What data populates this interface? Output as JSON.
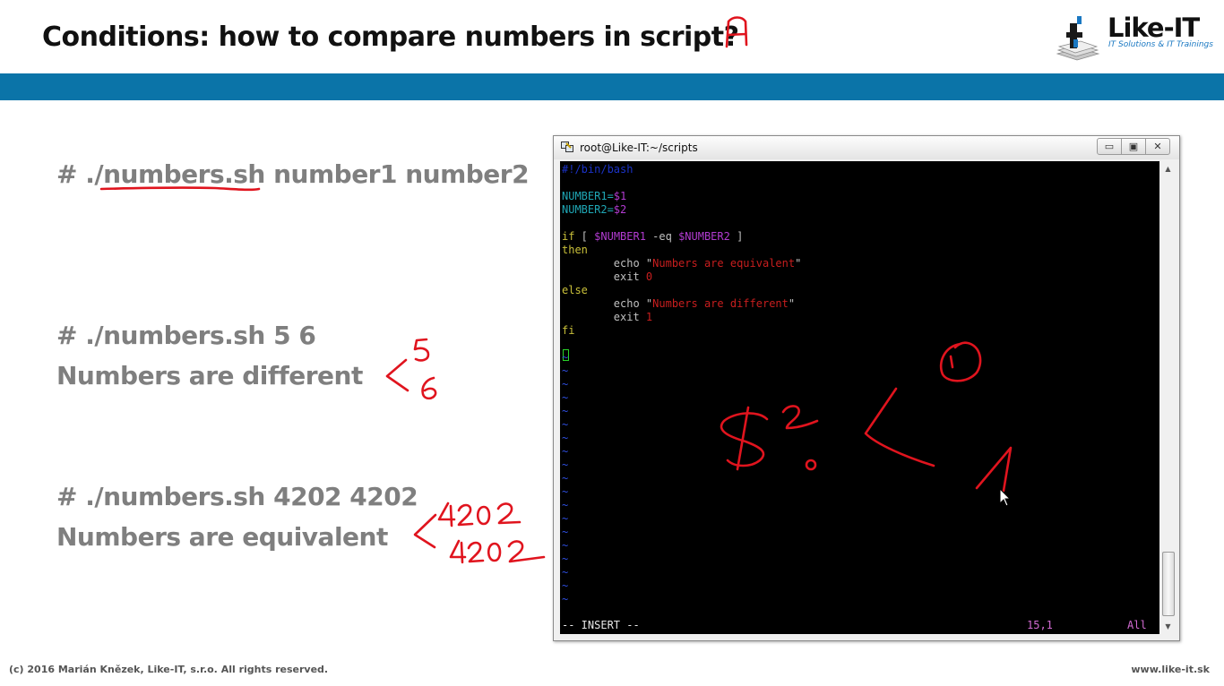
{
  "slide": {
    "title": "Conditions: how to compare numbers in script?",
    "bullets": [
      "# ./numbers.sh number1 number2",
      "# ./numbers.sh 5 6",
      "Numbers are different",
      "# ./numbers.sh 4202 4202",
      "Numbers are equivalent"
    ]
  },
  "logo": {
    "name": "Like-IT",
    "tagline": "IT Solutions & IT Trainings"
  },
  "footer": {
    "copyright": "(c) 2016 Marián Knězek, Like-IT, s.r.o. All rights reserved.",
    "website": "www.like-it.sk"
  },
  "terminal": {
    "title": "root@Like-IT:~/scripts",
    "buttons": {
      "minimize": "▭",
      "maximize": "▣",
      "close": "✕"
    },
    "script": {
      "shebang": "#!/bin/bash",
      "l1_var": "NUMBER1=",
      "l1_val": "$1",
      "l2_var": "NUMBER2=",
      "l2_val": "$2",
      "l3_if": "if",
      "l3_open": " [ ",
      "l3_var1": "$NUMBER1",
      "l3_op": " -eq ",
      "l3_var2": "$NUMBER2",
      "l3_close": " ]",
      "then": "then",
      "echo1_cmd": "        echo ",
      "echo1_q1": "\"",
      "echo1_text": "Numbers are equivalent",
      "echo1_q2": "\"",
      "exit1_cmd": "        exit ",
      "exit1_val": "0",
      "else": "else",
      "echo2_cmd": "        echo ",
      "echo2_q1": "\"",
      "echo2_text": "Numbers are different",
      "echo2_q2": "\"",
      "exit2_cmd": "        exit ",
      "exit2_val": "1",
      "fi": "fi"
    },
    "tilde": "~",
    "mode": "-- INSERT --",
    "position": "15,1",
    "scroll": "All"
  },
  "annotations": {
    "letter": "A",
    "first_pair": [
      "5",
      "6"
    ],
    "second_pair": [
      "4202",
      "4202"
    ],
    "dollar_var": "$?",
    "result_values": [
      "0",
      "1"
    ]
  },
  "colors": {
    "band": "#0b74a8",
    "ink": "#e0141e",
    "bullet_text": "#7f7f7f"
  }
}
